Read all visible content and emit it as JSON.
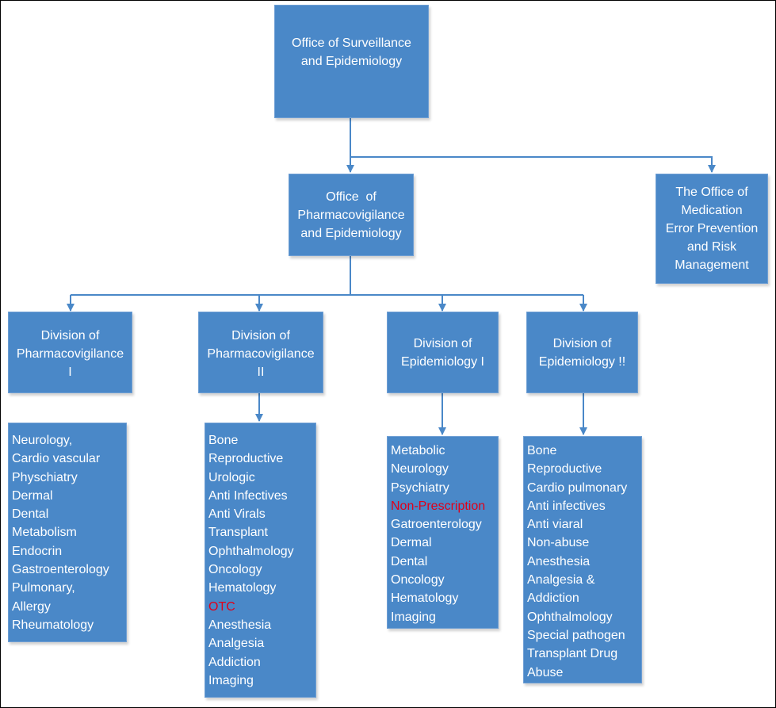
{
  "colors": {
    "box": "#4a88c8",
    "text": "#ffffff",
    "highlight": "#e0001a",
    "connector": "#4a88c8"
  },
  "nodes": {
    "root": [
      "Office of Surveillance",
      "and Epidemiology"
    ],
    "ope": [
      "Office  of",
      "Pharmacovigilance",
      "and Epidemiology"
    ],
    "medication": [
      "The Office of",
      "Medication",
      "Error Prevention",
      "and Risk",
      "Management"
    ],
    "dpv1": [
      "Division of",
      "Pharmacovigilance",
      "I"
    ],
    "dpv2": [
      "Division of",
      "Pharmacovigilance",
      "II"
    ],
    "de1": [
      "Division of",
      "Epidemiology I"
    ],
    "de2": [
      "Division of",
      "Epidemiology !!"
    ]
  },
  "lists": {
    "dpv1": [
      "Neurology,",
      "Cardio vascular",
      "Physchiatry",
      "Dermal",
      "Dental",
      "Metabolism",
      "Endocrin",
      "Gastroenterology",
      "Pulmonary,",
      "Allergy",
      "Rheumatology"
    ],
    "dpv2": [
      "Bone",
      "Reproductive",
      "Urologic",
      "Anti Infectives",
      "Anti Virals",
      "Transplant",
      "Ophthalmology",
      "Oncology",
      "Hematology",
      "OTC",
      "Anesthesia",
      "Analgesia",
      "Addiction",
      "Imaging"
    ],
    "de1": [
      "Metabolic",
      "Neurology",
      "Psychiatry",
      "Non-Prescription",
      "Gatroenterology",
      "Dermal",
      "Dental",
      "Oncology",
      "Hematology",
      "Imaging"
    ],
    "de2": [
      "Bone",
      "Reproductive",
      "Cardio pulmonary",
      "Anti infectives",
      "Anti viaral",
      "Non-abuse",
      "Anesthesia",
      "Analgesia &",
      "Addiction",
      "Ophthalmology",
      "Special pathogen",
      "Transplant Drug",
      "Abuse"
    ]
  },
  "highlighted_items": [
    "OTC",
    "Non-Prescription"
  ]
}
